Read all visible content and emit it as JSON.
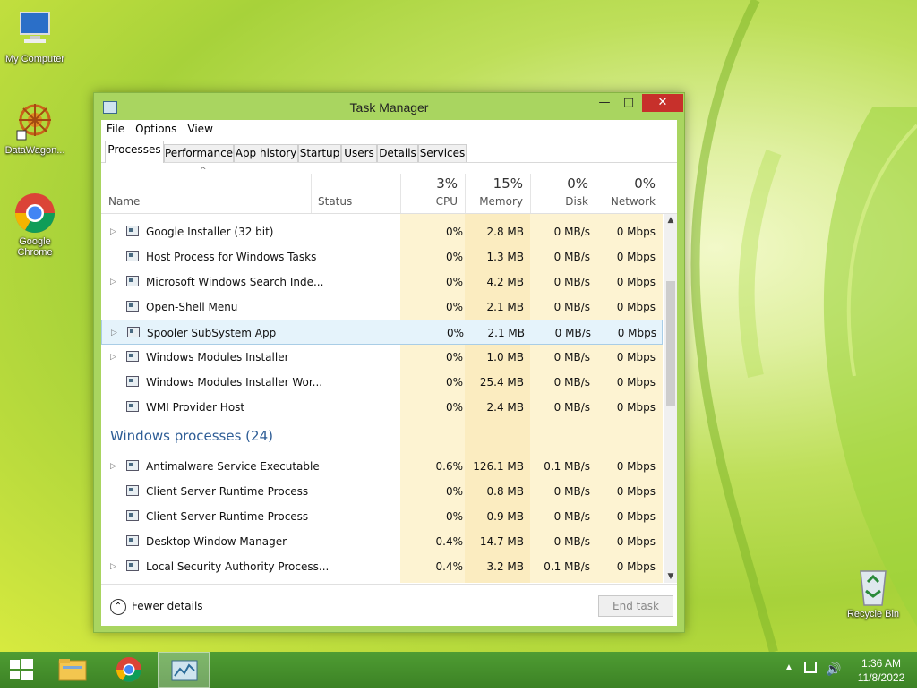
{
  "desktop": {
    "icons": [
      {
        "label": "My Computer"
      },
      {
        "label": "DataWagon..."
      },
      {
        "label": "Google Chrome"
      },
      {
        "label": "Recycle Bin"
      }
    ]
  },
  "window": {
    "title": "Task Manager",
    "menu": [
      "File",
      "Options",
      "View"
    ],
    "tabs": [
      "Processes",
      "Performance",
      "App history",
      "Startup",
      "Users",
      "Details",
      "Services"
    ],
    "active_tab": "Processes",
    "columns": {
      "name": "Name",
      "status": "Status",
      "cpu": {
        "pct": "3%",
        "label": "CPU"
      },
      "memory": {
        "pct": "15%",
        "label": "Memory"
      },
      "disk": {
        "pct": "0%",
        "label": "Disk"
      },
      "network": {
        "pct": "0%",
        "label": "Network"
      }
    },
    "rows": [
      {
        "name": "Google Installer (32 bit)",
        "cpu": "0%",
        "mem": "2.8 MB",
        "disk": "0 MB/s",
        "net": "0 Mbps",
        "expand": true
      },
      {
        "name": "Host Process for Windows Tasks",
        "cpu": "0%",
        "mem": "1.3 MB",
        "disk": "0 MB/s",
        "net": "0 Mbps",
        "expand": false
      },
      {
        "name": "Microsoft Windows Search Inde...",
        "cpu": "0%",
        "mem": "4.2 MB",
        "disk": "0 MB/s",
        "net": "0 Mbps",
        "expand": true
      },
      {
        "name": "Open-Shell Menu",
        "cpu": "0%",
        "mem": "2.1 MB",
        "disk": "0 MB/s",
        "net": "0 Mbps",
        "expand": false
      },
      {
        "name": "Spooler SubSystem App",
        "cpu": "0%",
        "mem": "2.1 MB",
        "disk": "0 MB/s",
        "net": "0 Mbps",
        "expand": true,
        "selected": true
      },
      {
        "name": "Windows Modules Installer",
        "cpu": "0%",
        "mem": "1.0 MB",
        "disk": "0 MB/s",
        "net": "0 Mbps",
        "expand": true
      },
      {
        "name": "Windows Modules Installer Wor...",
        "cpu": "0%",
        "mem": "25.4 MB",
        "disk": "0 MB/s",
        "net": "0 Mbps",
        "expand": false
      },
      {
        "name": "WMI Provider Host",
        "cpu": "0%",
        "mem": "2.4 MB",
        "disk": "0 MB/s",
        "net": "0 Mbps",
        "expand": false
      }
    ],
    "group": "Windows processes (24)",
    "group_rows": [
      {
        "name": "Antimalware Service Executable",
        "cpu": "0.6%",
        "mem": "126.1 MB",
        "disk": "0.1 MB/s",
        "net": "0 Mbps",
        "expand": true
      },
      {
        "name": "Client Server Runtime Process",
        "cpu": "0%",
        "mem": "0.8 MB",
        "disk": "0 MB/s",
        "net": "0 Mbps",
        "expand": false
      },
      {
        "name": "Client Server Runtime Process",
        "cpu": "0%",
        "mem": "0.9 MB",
        "disk": "0 MB/s",
        "net": "0 Mbps",
        "expand": false
      },
      {
        "name": "Desktop Window Manager",
        "cpu": "0.4%",
        "mem": "14.7 MB",
        "disk": "0 MB/s",
        "net": "0 Mbps",
        "expand": false
      },
      {
        "name": "Local Security Authority Process...",
        "cpu": "0.4%",
        "mem": "3.2 MB",
        "disk": "0.1 MB/s",
        "net": "0 Mbps",
        "expand": true
      }
    ],
    "footer": {
      "fewer_details": "Fewer details",
      "end_task": "End task"
    }
  },
  "taskbar": {
    "time": "1:36 AM",
    "date": "11/8/2022"
  },
  "colors": {
    "heat_light": "#fdf6dc",
    "heat_mid": "#fbeec0",
    "heat_strong": "#f8e6a6",
    "group_title": "#2e5d96",
    "close_red": "#c7302b"
  }
}
